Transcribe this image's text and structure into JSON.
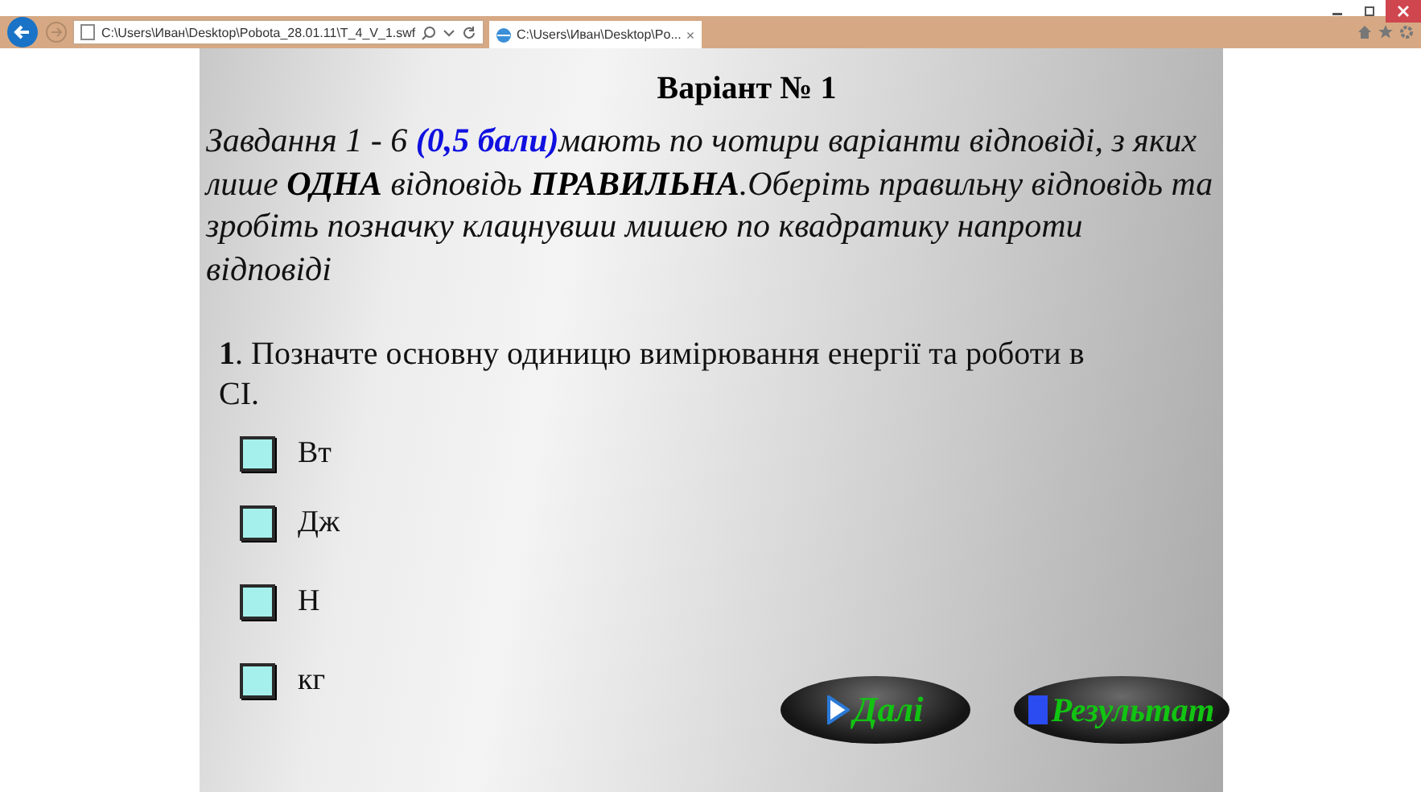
{
  "browser": {
    "address": "C:\\Users\\Иван\\Desktop\\Pobota_28.01.11\\T_4_V_1.swf",
    "tab": {
      "title": "C:\\Users\\Иван\\Desktop\\Po...",
      "close": "×",
      "selected": true
    }
  },
  "title": "Варіант № 1",
  "instructions": "Завдання 1 - 6 **(0,5 бали)**мають по чотири варіанти відповіді, з яких лише **ОДНА** відповідь **ПРАВИЛЬНА**.Оберіть правильну відповідь та зробіть позначку клацнувши мишею по квадратику напроти   відповіді",
  "question": {
    "number": "1",
    "text": ". Позначте основну одиницю вимірювання енергії та роботи в СІ."
  },
  "options": [
    {
      "label": "Вт",
      "checked": false
    },
    {
      "label": "Дж",
      "checked": false
    },
    {
      "label": "Н",
      "checked": false
    },
    {
      "label": "кг",
      "checked": false
    }
  ],
  "buttons": [
    {
      "label": "Далі",
      "kind": "next"
    },
    {
      "label": "Результат",
      "kind": "result"
    }
  ]
}
